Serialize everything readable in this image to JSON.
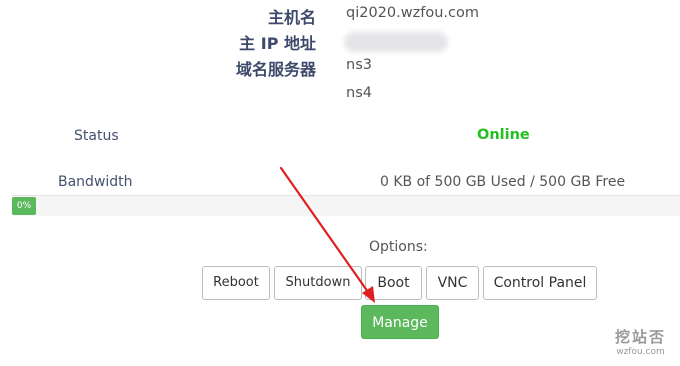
{
  "server_info": {
    "hostname_label": "主机名",
    "hostname_value": "qi2020.wzfou.com",
    "ip_label": "主 IP 地址",
    "ns_label": "域名服务器",
    "ns1": "ns3",
    "ns2": "ns4"
  },
  "status": {
    "label": "Status",
    "value": "Online"
  },
  "bandwidth": {
    "label": "Bandwidth",
    "usage": "0 KB of 500 GB Used / 500 GB Free",
    "percent_label": "0%",
    "percent": 0
  },
  "options": {
    "label": "Options:",
    "buttons": [
      "Reboot",
      "Shutdown",
      "Boot",
      "VNC",
      "Control Panel"
    ],
    "manage": "Manage"
  },
  "watermark": {
    "title": "挖站否",
    "domain": "wzfou.com"
  },
  "colors": {
    "online": "#22c020",
    "progress": "#5cb85c",
    "manage": "#5cb85c",
    "annotation_arrow": "#e02020"
  }
}
